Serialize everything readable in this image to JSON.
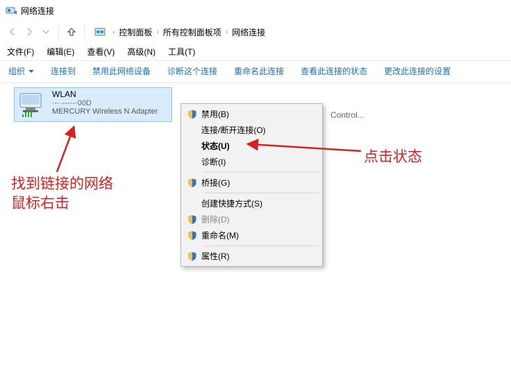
{
  "window": {
    "title": "网络连接"
  },
  "breadcrumbs": {
    "items": [
      "控制面板",
      "所有控制面板项",
      "网络连接"
    ]
  },
  "menubar": {
    "file": "文件(F)",
    "edit": "编辑(E)",
    "view": "查看(V)",
    "advanced": "高级(N)",
    "tools": "工具(T)"
  },
  "toolbar": {
    "organize": "组织",
    "connect_to": "连接到",
    "disable_dev": "禁用此网络设备",
    "diagnose": "诊断这个连接",
    "rename": "重命名此连接",
    "view_status": "查看此连接的状态",
    "change_set": "更改此连接的设置"
  },
  "adapter": {
    "name": "WLAN",
    "ssid_masked": "·-··---·-·00D",
    "device": "MERCURY Wireless N Adapter"
  },
  "partial_bg_item": "Control...",
  "context_menu": [
    {
      "icon": "shield",
      "label": "禁用(B)"
    },
    {
      "label": "连接/断开连接(O)"
    },
    {
      "label": "状态(U)",
      "highlight": true
    },
    {
      "label": "诊断(I)"
    },
    {
      "sep": true
    },
    {
      "icon": "shield",
      "label": "桥接(G)"
    },
    {
      "sep": true
    },
    {
      "label": "创建快捷方式(S)"
    },
    {
      "icon": "shield",
      "label": "删除(D)",
      "disabled": true
    },
    {
      "icon": "shield",
      "label": "重命名(M)"
    },
    {
      "sep": true
    },
    {
      "icon": "shield",
      "label": "属性(R)"
    }
  ],
  "annotations": {
    "left_line1": "找到链接的网络",
    "left_line2": "鼠标右击",
    "right": "点击状态"
  }
}
